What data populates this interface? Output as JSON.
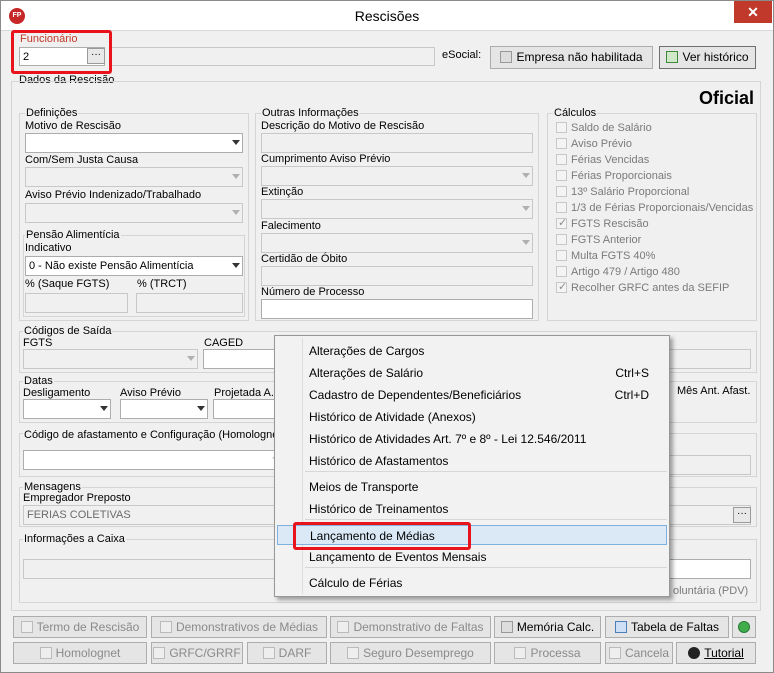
{
  "window": {
    "title": "Rescisões",
    "close": "✕",
    "app_icon": "FP"
  },
  "header": {
    "funcionario_label": "Funcionário",
    "funcionario_value": "2",
    "esocial_label": "eSocial:",
    "empresa_btn": "Empresa não habilitada",
    "ver_historico_btn": "Ver histórico",
    "dados_label": "Dados da Rescisão",
    "oficial": "Oficial"
  },
  "definicoes": {
    "group": "Definições",
    "motivo_label": "Motivo de Rescisão",
    "justa_label": "Com/Sem Justa Causa",
    "aviso_label": "Aviso Prévio Indenizado/Trabalhado",
    "pensao_group": "Pensão Alimentícia",
    "indicativo_label": "Indicativo",
    "indicativo_value": "0 - Não existe Pensão Alimentícia",
    "saque_label": "% (Saque FGTS)",
    "trct_label": "% (TRCT)"
  },
  "outras": {
    "group": "Outras Informações",
    "descricao_label": "Descrição do Motivo de Rescisão",
    "cumprimento_label": "Cumprimento Aviso Prévio",
    "extincao_label": "Extinção",
    "falecimento_label": "Falecimento",
    "certidao_label": "Certidão de Óbito",
    "processo_label": "Número de Processo"
  },
  "calculos": {
    "group": "Cálculos",
    "items": [
      {
        "label": "Saldo de Salário",
        "checked": false
      },
      {
        "label": "Aviso Prévio",
        "checked": false
      },
      {
        "label": "Férias Vencidas",
        "checked": false
      },
      {
        "label": "Férias Proporcionais",
        "checked": false
      },
      {
        "label": "13º Salário Proporcional",
        "checked": false
      },
      {
        "label": "1/3 de Férias Proporcionais/Vencidas",
        "checked": false
      },
      {
        "label": "FGTS Rescisão",
        "checked": true
      },
      {
        "label": "FGTS Anterior",
        "checked": false
      },
      {
        "label": "Multa FGTS 40%",
        "checked": false
      },
      {
        "label": "Artigo 479 / Artigo 480",
        "checked": false
      },
      {
        "label": "Recolher GRFC antes da SEFIP",
        "checked": true
      }
    ]
  },
  "codigos": {
    "group": "Códigos de Saída",
    "fgts_label": "FGTS",
    "caged_label": "CAGED"
  },
  "datas": {
    "group": "Datas",
    "desligamento": "Desligamento",
    "aviso": "Aviso Prévio",
    "projetada": "Projetada A.",
    "mes_ant": "Mês Ant. Afast."
  },
  "afastamento": {
    "label": "Código de afastamento e Configuração (Homolognet"
  },
  "mensagens": {
    "group": "Mensagens",
    "empregador_label": "Empregador Preposto",
    "empregador_value": "FERIAS COLETIVAS"
  },
  "caixa": {
    "group": "Informações a Caixa",
    "pdv_text": "oluntária (PDV)"
  },
  "context_menu": {
    "items": [
      {
        "label": "Alterações de Cargos",
        "shortcut": ""
      },
      {
        "label": "Alterações de Salário",
        "shortcut": "Ctrl+S"
      },
      {
        "label": "Cadastro de Dependentes/Beneficiários",
        "shortcut": "Ctrl+D"
      },
      {
        "label": "Histórico de Atividade (Anexos)",
        "shortcut": ""
      },
      {
        "label": "Histórico de Atividades Art. 7º e 8º - Lei 12.546/2011",
        "shortcut": ""
      },
      {
        "label": "Histórico de Afastamentos",
        "shortcut": ""
      },
      {
        "label": "Meios de Transporte",
        "shortcut": ""
      },
      {
        "label": "Histórico de Treinamentos",
        "shortcut": ""
      },
      {
        "label": "Lançamento de Médias",
        "shortcut": ""
      },
      {
        "label": "Lançamento de Eventos Mensais",
        "shortcut": ""
      },
      {
        "label": "Cálculo de Férias",
        "shortcut": ""
      }
    ]
  },
  "buttons_row1": {
    "termo": "Termo de Rescisão",
    "demonstrativos_medias": "Demonstrativos de Médias",
    "demonstrativo_faltas": "Demonstrativo de Faltas",
    "memoria": "Memória Calc.",
    "tabela_faltas": "Tabela de Faltas"
  },
  "buttons_row2": {
    "homolognet": "Homolognet",
    "grfc": "GRFC/GRRF",
    "darf": "DARF",
    "seguro": "Seguro Desemprego",
    "processa": "Processa",
    "cancela": "Cancela",
    "tutorial": "Tutorial"
  },
  "colors": {
    "highlight_red": "#e8131b",
    "menu_highlight": "#dbe9f7",
    "close_red": "#c0392b"
  }
}
